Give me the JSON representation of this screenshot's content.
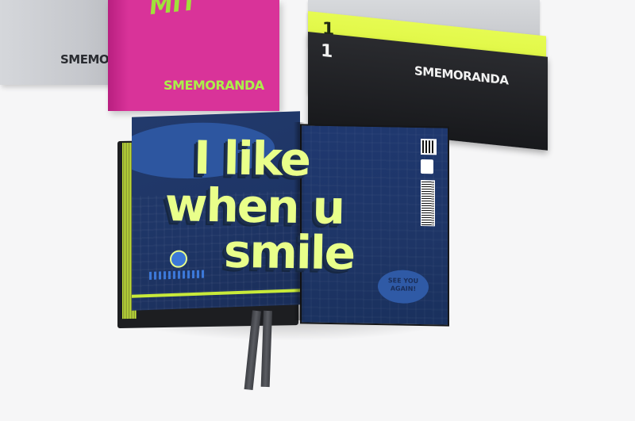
{
  "brand": "SMEMORANDA",
  "cover_lettering": "MIT",
  "spine_number": "1",
  "headline": {
    "line1": "I like",
    "line2": "when u",
    "line3": "smile"
  },
  "bubble_text": {
    "line1": "SEE YOU",
    "line2": "AGAIN!"
  },
  "colors": {
    "background": "#f6f6f7",
    "silver_cover": "#c9cbd0",
    "magenta_cover": "#d62f98",
    "lime_cover": "#dbf531",
    "black_cover": "#1d1e21",
    "page_navy": "#1e3566",
    "page_blue": "#2f5aa6",
    "headline_lime": "#e9ff8a",
    "bookmark_grey": "#4e5056"
  }
}
